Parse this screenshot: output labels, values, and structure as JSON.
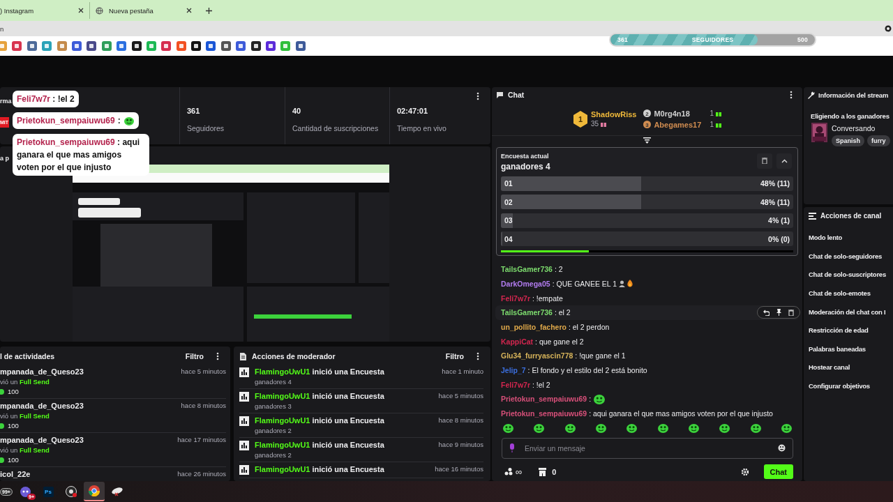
{
  "browser": {
    "tabs": [
      {
        "label": ") Instagram"
      },
      {
        "label": "Nueva pestaña"
      }
    ],
    "address": "n",
    "bookmarks": [
      {
        "color": "#e6a23c"
      },
      {
        "color": "#d8344f"
      },
      {
        "color": "#4d6a99"
      },
      {
        "color": "#2aa3b8"
      },
      {
        "color": "#c48a4a"
      },
      {
        "color": "#3d5bd9"
      },
      {
        "color": "#4a4a8a"
      },
      {
        "color": "#2f9e5a"
      },
      {
        "color": "#2b6fe0"
      },
      {
        "color": "#1a1a1a"
      },
      {
        "color": "#1db954"
      },
      {
        "color": "#d62d4f"
      },
      {
        "color": "#f25022"
      },
      {
        "color": "#111111"
      },
      {
        "color": "#1a56d6"
      },
      {
        "color": "#555555"
      },
      {
        "color": "#3d5bd9"
      },
      {
        "color": "#222222"
      },
      {
        "color": "#5b2bd9"
      },
      {
        "color": "#2fbf3a"
      },
      {
        "color": "#3d5a99"
      }
    ]
  },
  "follower_goal": {
    "current": "361",
    "label": "SEGUIDORES",
    "target": "500",
    "level": 0.72
  },
  "overlay_chat": [
    {
      "kind": "text",
      "user": "Feli7w7r",
      "text": ": !el 2"
    },
    {
      "kind": "emote",
      "user": "Prietokun_sempaiuwu69",
      "text": ":"
    },
    {
      "kind": "text",
      "user": "Prietokun_sempaiuwu69",
      "text": ": aqui ganara el que mas amigos voten por el que injusto"
    }
  ],
  "stats": {
    "title": "rma",
    "badge": "MIT",
    "items": [
      {
        "value": "361",
        "label": "Seguidores"
      },
      {
        "value": "40",
        "label": "Cantidad de suscripciones"
      },
      {
        "value": "02:47:01",
        "label": "Tiempo en vivo"
      }
    ]
  },
  "preview": {
    "title": "a p"
  },
  "activity": {
    "title": "l de actividades",
    "filter": "Filtro",
    "items": [
      {
        "user": "mpanada_de_Queso23",
        "action": "vió un",
        "item": "Full Send",
        "amount": "100",
        "time": "hace 5 minutos"
      },
      {
        "user": "mpanada_de_Queso23",
        "action": "vió un",
        "item": "Full Send",
        "amount": "100",
        "time": "hace 8 minutos"
      },
      {
        "user": "mpanada_de_Queso23",
        "action": "vió un",
        "item": "Full Send",
        "amount": "100",
        "time": "hace 17 minutos"
      },
      {
        "user": "icol_22e",
        "time": "hace 26 minutos"
      }
    ]
  },
  "moderator_actions": {
    "title": "Acciones de moderador",
    "filter": "Filtro",
    "items": [
      {
        "user": "FlamingoUwU1",
        "action": "inició una Encuesta",
        "detail": "ganadores 4",
        "time": "hace 1 minuto"
      },
      {
        "user": "FlamingoUwU1",
        "action": "inició una Encuesta",
        "detail": "ganadores 3",
        "time": "hace 5 minutos"
      },
      {
        "user": "FlamingoUwU1",
        "action": "inició una Encuesta",
        "detail": "ganadores 2",
        "time": "hace 8 minutos"
      },
      {
        "user": "FlamingoUwU1",
        "action": "inició una Encuesta",
        "detail": "ganadores 2",
        "time": "hace 9 minutos"
      },
      {
        "user": "FlamingoUwU1",
        "action": "inició una Encuesta",
        "time": "hace 16 minutos"
      }
    ]
  },
  "chat": {
    "title": "Chat",
    "leaderboard": [
      {
        "rank": "1",
        "user": "ShadowRiss",
        "count": "35",
        "color": "#f0b93a"
      },
      {
        "rank": "2",
        "user": "M0rg4n18",
        "count": "1",
        "color": "#d0d0d0"
      },
      {
        "rank": "3",
        "user": "Abegames17",
        "count": "1",
        "color": "#d08c50"
      }
    ],
    "poll": {
      "label": "Encuesta actual",
      "title": "ganadores 4",
      "options": [
        {
          "name": "01",
          "level": 0.48,
          "reading": "48% (11)"
        },
        {
          "name": "02",
          "level": 0.48,
          "reading": "48% (11)"
        },
        {
          "name": "03",
          "level": 0.04,
          "reading": "4% (1)"
        },
        {
          "name": "04",
          "level": 0,
          "reading": "0% (0)"
        }
      ],
      "timer": {
        "level": 0.3
      }
    },
    "messages": [
      {
        "kind": "text",
        "user": "TailsGamer736",
        "color": "#7ddc6e",
        "text": ": 2",
        "hovered": false
      },
      {
        "kind": "text-emotes",
        "user": "DarkOmega05",
        "color": "#b27cf0",
        "text": ": QUE GANEE EL 1",
        "hovered": false
      },
      {
        "kind": "text",
        "user": "Feli7w7r",
        "color": "#d4264f",
        "text": ": !empate",
        "hovered": false
      },
      {
        "kind": "text",
        "user": "TailsGamer736",
        "color": "#7ddc6e",
        "text": ": el 2",
        "hovered": true
      },
      {
        "kind": "text",
        "user": "un_pollito_fachero",
        "color": "#e0a94a",
        "text": ": el 2 perdon",
        "hovered": false
      },
      {
        "kind": "text",
        "user": "KappiCat",
        "color": "#d4264f",
        "text": ": que gane el 2",
        "hovered": false
      },
      {
        "kind": "text",
        "user": "Glu34_furryascin778",
        "color": "#d8b45a",
        "text": ": !que gane el 1",
        "hovered": false
      },
      {
        "kind": "text",
        "user": "Jelip_7",
        "color": "#3b6fe0",
        "text": ": El fondo y el estilo del 2 está bonito",
        "hovered": false
      },
      {
        "kind": "text",
        "user": "Feli7w7r",
        "color": "#d4264f",
        "text": ": !el 2",
        "hovered": false
      },
      {
        "kind": "emote",
        "user": "Prietokun_sempaiuwu69",
        "color": "#d9507a",
        "text": ":",
        "hovered": false
      },
      {
        "kind": "text",
        "user": "Prietokun_sempaiuwu69",
        "color": "#d9507a",
        "text": ": aqui ganara el que mas amigos voten por el que injusto",
        "hovered": false
      }
    ],
    "input": {
      "placeholder": "Enviar un mensaje"
    },
    "points": "∞",
    "store_count": "0",
    "send_button": "Chat"
  },
  "stream_info": {
    "title": "Información del stream",
    "stream_title": "Eligiendo a los ganadores",
    "category": "Conversando",
    "tags": [
      "Spanish",
      "furry"
    ]
  },
  "channel_actions": {
    "title": "Acciones de canal",
    "items": [
      "Modo lento",
      "Chat de solo-seguidores",
      "Chat de solo-suscriptores",
      "Chat de solo-emotes",
      "Moderación del chat con I",
      "Restricción de edad",
      "Palabras baneadas",
      "Hostear canal",
      "Configurar objetivos"
    ]
  },
  "taskbar": [
    {
      "kind": "badge-app",
      "badge": "99+",
      "active": false
    },
    {
      "kind": "chat-app",
      "badge": "9+",
      "active": false
    },
    {
      "kind": "photo-app",
      "label": "Ps",
      "active": false
    },
    {
      "kind": "record-app",
      "active": false
    },
    {
      "kind": "browser-app",
      "active": true
    },
    {
      "kind": "tool-app",
      "active": false
    }
  ]
}
